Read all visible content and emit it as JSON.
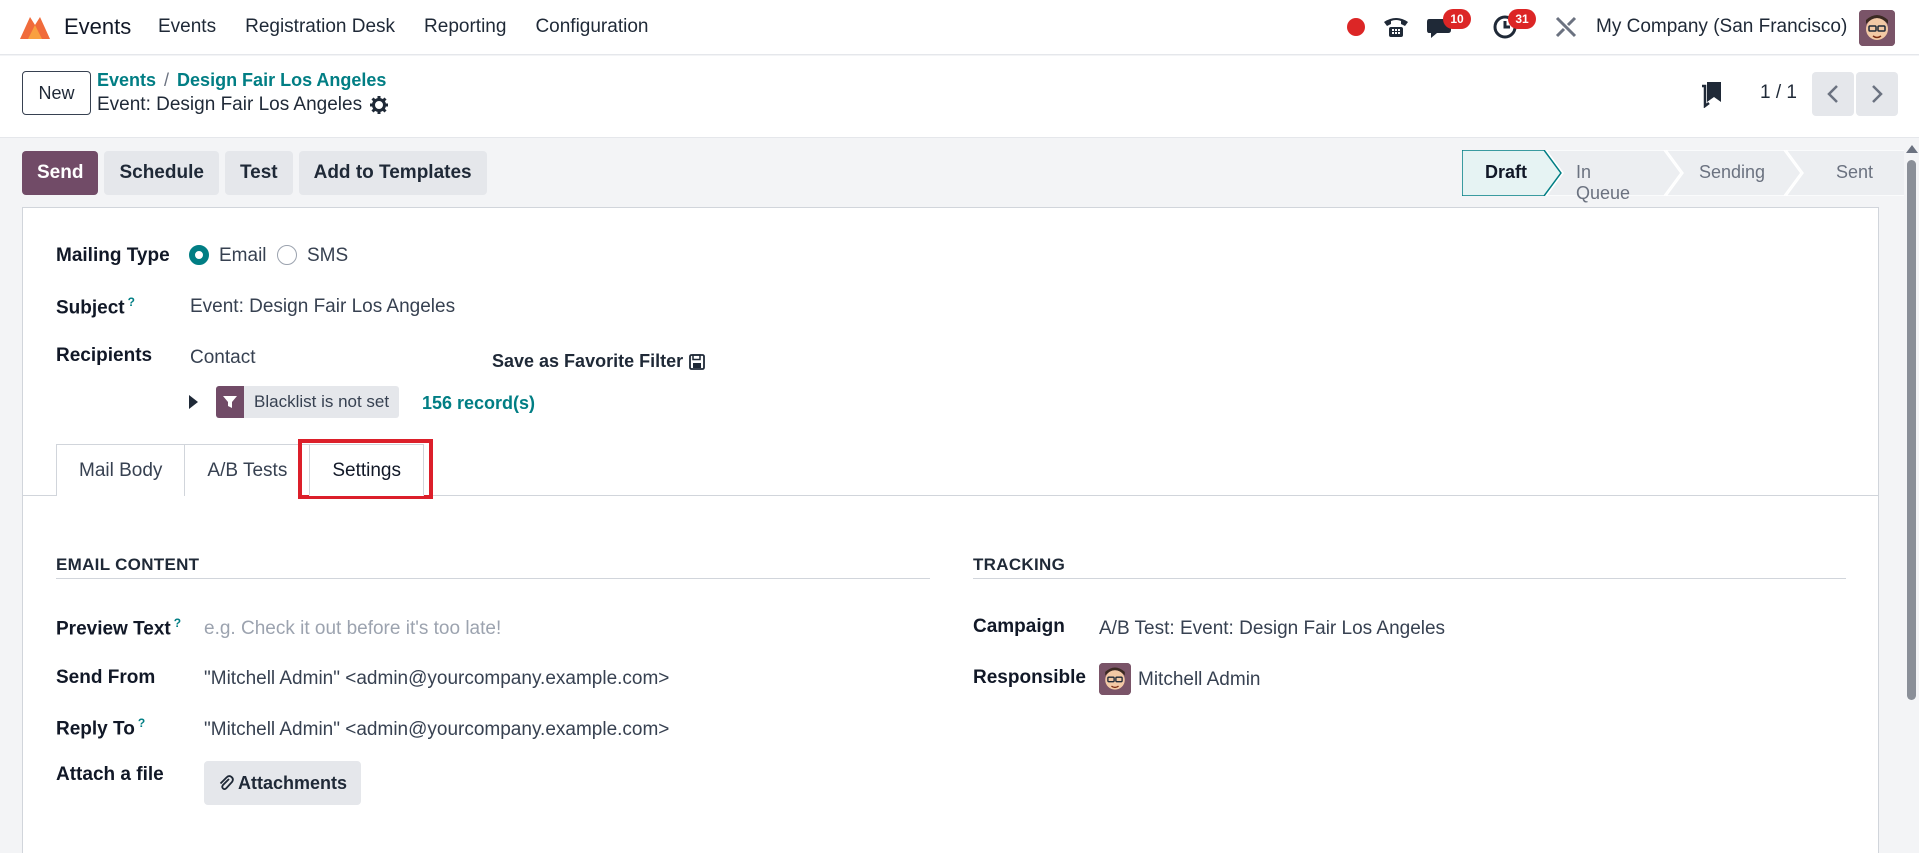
{
  "topbar": {
    "app_name": "Events",
    "menu": [
      "Events",
      "Registration Desk",
      "Reporting",
      "Configuration"
    ],
    "chat_count": "10",
    "activity_count": "31",
    "company": "My Company (San Francisco)"
  },
  "control": {
    "new_label": "New",
    "breadcrumb": [
      "Events",
      "Design Fair Los Angeles"
    ],
    "record_title": "Event: Design Fair Los Angeles",
    "pager": "1 / 1"
  },
  "actions": [
    "Send",
    "Schedule",
    "Test",
    "Add to Templates"
  ],
  "stages": [
    "Draft",
    "In Queue",
    "Sending",
    "Sent"
  ],
  "form": {
    "mailing_type_label": "Mailing Type",
    "mailing_type_options": [
      "Email",
      "SMS"
    ],
    "mailing_type_selected": "Email",
    "subject_label": "Subject",
    "subject_value": "Event: Design Fair Los Angeles",
    "recipients_label": "Recipients",
    "recipients_value": "Contact",
    "save_filter_label": "Save as Favorite Filter",
    "filter_chip": "Blacklist is not set",
    "records": "156 record(s)"
  },
  "tabs": [
    "Mail Body",
    "A/B Tests",
    "Settings"
  ],
  "active_tab": "Settings",
  "email_content": {
    "title": "EMAIL CONTENT",
    "preview_label": "Preview Text",
    "preview_placeholder": "e.g. Check it out before it's too late!",
    "send_from_label": "Send From",
    "send_from_value": "\"Mitchell Admin\" <admin@yourcompany.example.com>",
    "reply_to_label": "Reply To",
    "reply_to_value": "\"Mitchell Admin\" <admin@yourcompany.example.com>",
    "attach_label": "Attach a file",
    "attach_button": "Attachments"
  },
  "tracking": {
    "title": "TRACKING",
    "campaign_label": "Campaign",
    "campaign_value": "A/B Test: Event: Design Fair Los Angeles",
    "responsible_label": "Responsible",
    "responsible_value": "Mitchell Admin"
  },
  "colors": {
    "brand": "#714b67",
    "accent": "#017e84",
    "highlight": "#dc1f2a"
  }
}
